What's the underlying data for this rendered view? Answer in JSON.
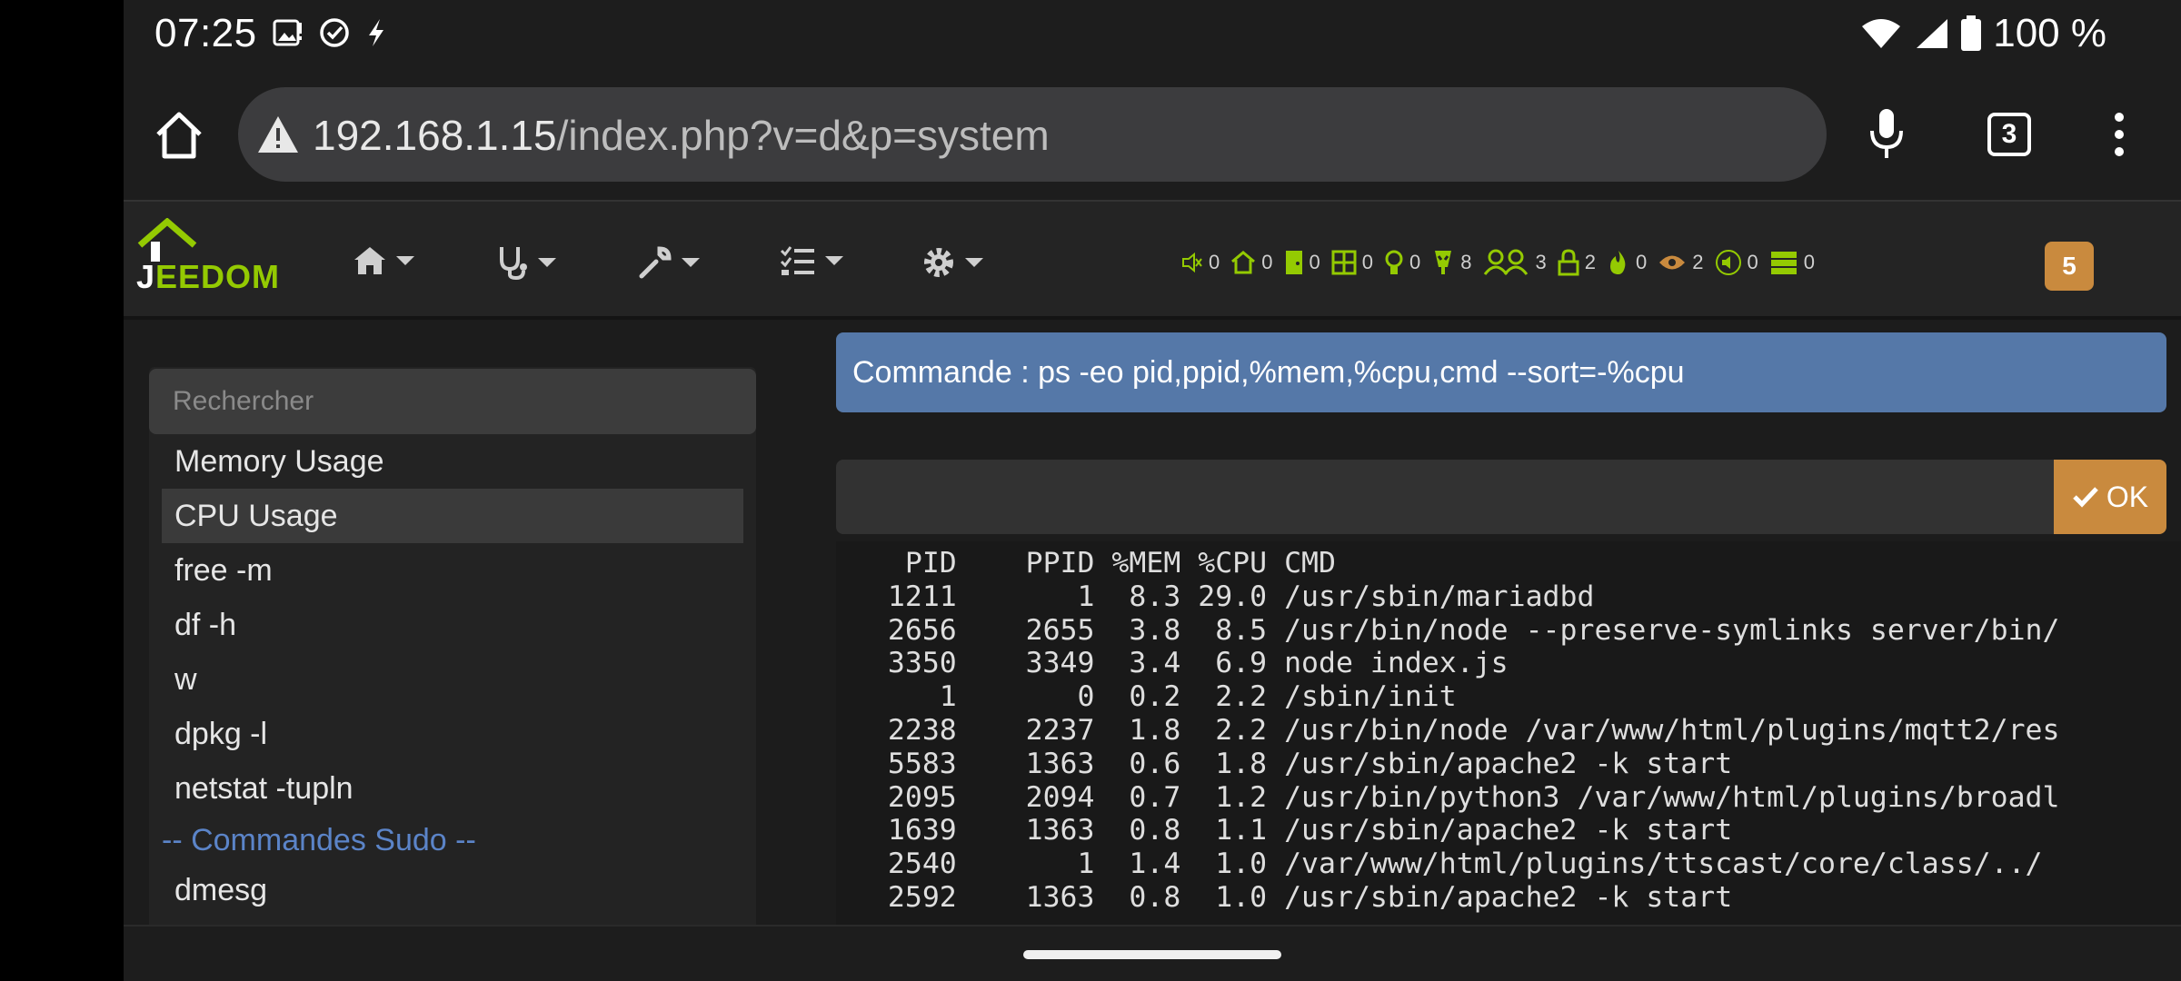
{
  "status_bar": {
    "time": "07:25",
    "battery": "100 %",
    "icons": [
      "gallery-icon",
      "check-circle-icon",
      "bolt-icon",
      "wifi-icon",
      "signal-icon",
      "battery-icon"
    ]
  },
  "browser": {
    "url_host": "192.168.1.15",
    "url_path": "/index.php?v=d&p=system",
    "tab_count": "3"
  },
  "jeedom": {
    "logo_text_1": "J",
    "logo_text_2": "EEDOM",
    "nav_menus": [
      "home-icon",
      "stethoscope-icon",
      "wrench-icon",
      "tasks-icon",
      "gear-icon"
    ],
    "summary": [
      {
        "icon": "mute-icon",
        "value": "0"
      },
      {
        "icon": "house-icon",
        "value": "0"
      },
      {
        "icon": "door-icon",
        "value": "0"
      },
      {
        "icon": "window-icon",
        "value": "0"
      },
      {
        "icon": "bulb-icon",
        "value": "0"
      },
      {
        "icon": "plug-icon",
        "value": "8"
      },
      {
        "icon": "people-icon",
        "value": "3"
      },
      {
        "icon": "lock-icon",
        "value": "2"
      },
      {
        "icon": "fire-icon",
        "value": "0"
      },
      {
        "icon": "eye-icon",
        "value": "2"
      },
      {
        "icon": "speaker-icon",
        "value": "0"
      },
      {
        "icon": "shutter-icon",
        "value": "0"
      }
    ],
    "message_count": "5",
    "accent": "#94ca02"
  },
  "sidebar": {
    "search_placeholder": "Rechercher",
    "items": [
      {
        "label": "Memory Usage"
      },
      {
        "label": "CPU Usage"
      },
      {
        "label": "free -m"
      },
      {
        "label": "df -h"
      },
      {
        "label": "w"
      },
      {
        "label": "dpkg -l"
      },
      {
        "label": "netstat -tupln"
      }
    ],
    "group_label": "-- Commandes Sudo --",
    "sudo_items": [
      {
        "label": "dmesg"
      }
    ]
  },
  "main": {
    "command_banner": "Commande : ps -eo pid,ppid,%mem,%cpu,cmd --sort=-%cpu",
    "ok_label": "OK",
    "output_lines": [
      "    PID    PPID %MEM %CPU CMD",
      "   1211       1  8.3 29.0 /usr/sbin/mariadbd",
      "   2656    2655  3.8  8.5 /usr/bin/node --preserve-symlinks server/bin/",
      "   3350    3349  3.4  6.9 node index.js",
      "      1       0  0.2  2.2 /sbin/init",
      "   2238    2237  1.8  2.2 /usr/bin/node /var/www/html/plugins/mqtt2/res",
      "   5583    1363  0.6  1.8 /usr/sbin/apache2 -k start",
      "   2095    2094  0.7  1.2 /usr/bin/python3 /var/www/html/plugins/broadl",
      "   1639    1363  0.8  1.1 /usr/sbin/apache2 -k start",
      "   2540       1  1.4  1.0 /var/www/html/plugins/ttscast/core/class/../",
      "   2592    1363  0.8  1.0 /usr/sbin/apache2 -k start"
    ]
  }
}
